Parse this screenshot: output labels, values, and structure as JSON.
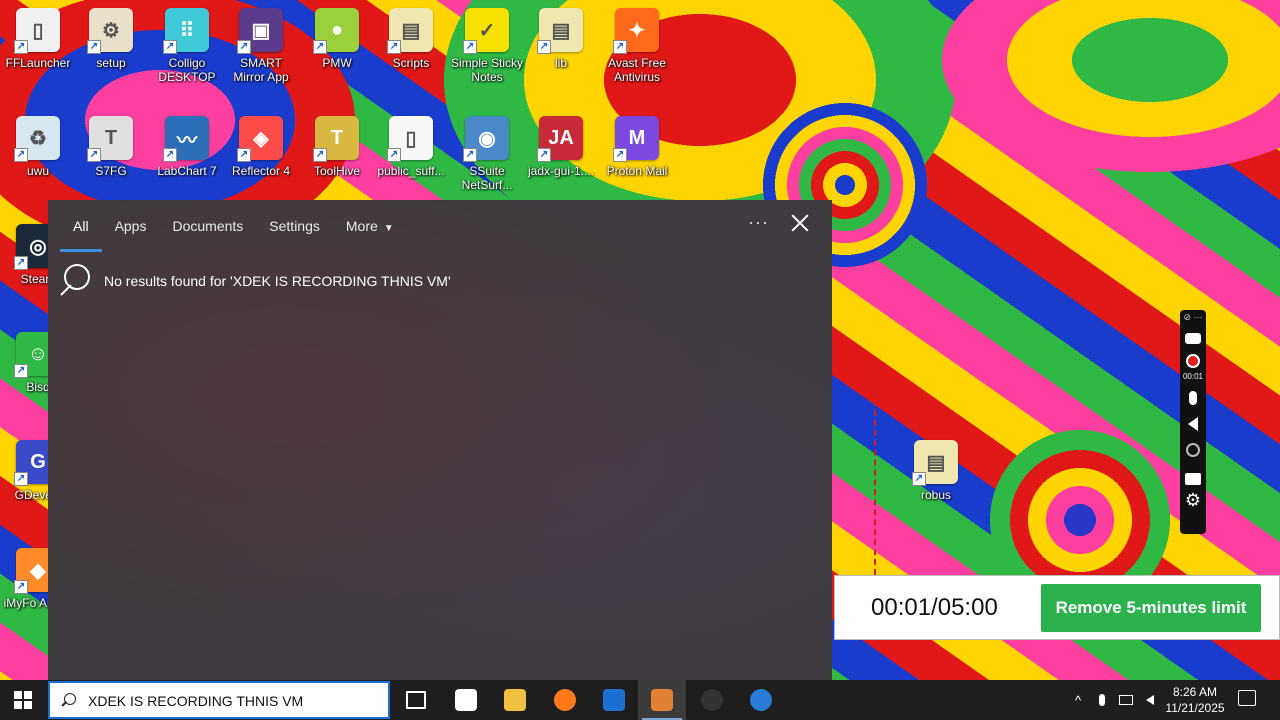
{
  "desktop": {
    "icons": [
      {
        "label": "FFLauncher",
        "color": "#f0f0f0",
        "glyph": "▯"
      },
      {
        "label": "setup",
        "color": "#e8e0c8",
        "glyph": "⚙"
      },
      {
        "label": "Colligo DESKTOP",
        "color": "#3fc8d8",
        "glyph": "⠿"
      },
      {
        "label": "SMART Mirror App",
        "color": "#5a3b8c",
        "glyph": "▣"
      },
      {
        "label": "PMW",
        "color": "#9ad03a",
        "glyph": "●"
      },
      {
        "label": "Scripts",
        "color": "#f0e6b0",
        "glyph": "▤"
      },
      {
        "label": "Simple Sticky Notes",
        "color": "#f5e000",
        "glyph": "✓"
      },
      {
        "label": "lib",
        "color": "#f0e6b0",
        "glyph": "▤"
      },
      {
        "label": "Avast Free Antivirus",
        "color": "#ff6a1a",
        "glyph": "✦"
      },
      {
        "label": "uwu",
        "color": "#d8e8f0",
        "glyph": "♻"
      },
      {
        "label": "S7FG",
        "color": "#e0e0e0",
        "glyph": "T"
      },
      {
        "label": "LabChart 7",
        "color": "#2a6fb8",
        "glyph": "〰"
      },
      {
        "label": "Reflector 4",
        "color": "#ff4a4a",
        "glyph": "◈"
      },
      {
        "label": "ToolHive",
        "color": "#d8b840",
        "glyph": "T"
      },
      {
        "label": "public_suff...",
        "color": "#f8f8f8",
        "glyph": "▯"
      },
      {
        "label": "SSuite NetSurf...",
        "color": "#4a8ac8",
        "glyph": "◉"
      },
      {
        "label": "jadx-gui-1....",
        "color": "#c82a3a",
        "glyph": "JA"
      },
      {
        "label": "Proton Mail",
        "color": "#7a4ae0",
        "glyph": "M"
      },
      {
        "label": "Steam",
        "color": "#1b2838",
        "glyph": "◎"
      },
      {
        "label": "Bisq",
        "color": "#2fb844",
        "glyph": "☺"
      },
      {
        "label": "GDevelo",
        "color": "#3a4ac8",
        "glyph": "G"
      },
      {
        "label": "iMyFo AnyTo",
        "color": "#ff8a2a",
        "glyph": "◆"
      },
      {
        "label": "robus",
        "color": "#f0e6b0",
        "glyph": "▤"
      }
    ]
  },
  "search_panel": {
    "tabs": [
      "All",
      "Apps",
      "Documents",
      "Settings",
      "More"
    ],
    "active_tab": "All",
    "more_caret": "▼",
    "dots": "···",
    "no_results": "No results found for 'XDEK IS RECORDING THNIS VM'"
  },
  "recorder": {
    "elapsed_small": "00:01",
    "timer": "00:01/05:00",
    "remove_limit_label": "Remove 5-minutes limit",
    "gear": "⚙",
    "top_icon": "⊘ ···"
  },
  "taskbar": {
    "search_value": "XDEK IS RECORDING THNIS VM",
    "apps": [
      {
        "name": "task-view",
        "color": "#1e1e1e",
        "glyph": "⧉"
      },
      {
        "name": "notepad",
        "color": "#ffffff",
        "glyph": ""
      },
      {
        "name": "file-explorer",
        "color": "#f0c040",
        "glyph": ""
      },
      {
        "name": "firefox",
        "color": "#ff7a1a",
        "glyph": ""
      },
      {
        "name": "outlook",
        "color": "#1a6fd1",
        "glyph": ""
      },
      {
        "name": "recorder-app",
        "color": "#e08030",
        "glyph": ""
      },
      {
        "name": "obs",
        "color": "#333333",
        "glyph": ""
      },
      {
        "name": "screen-app",
        "color": "#2a7ad8",
        "glyph": ""
      }
    ],
    "tray_chevron": "^",
    "time": "8:26 AM",
    "date": "11/21/2025"
  }
}
